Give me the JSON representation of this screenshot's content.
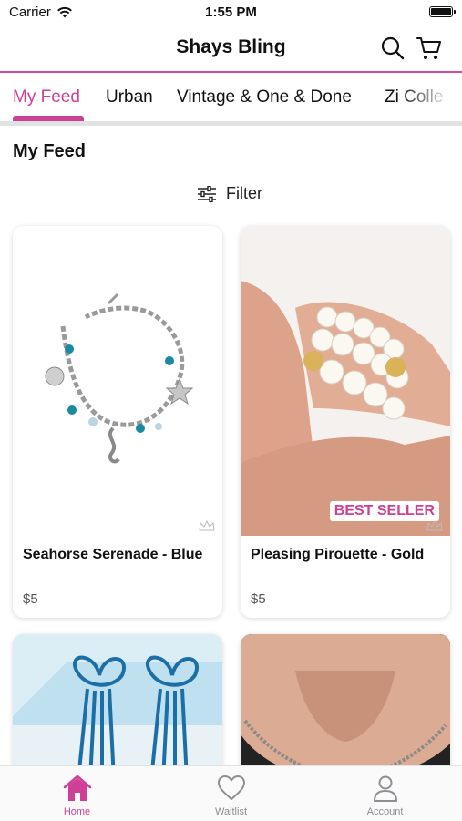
{
  "status_bar": {
    "carrier": "Carrier",
    "time": "1:55 PM"
  },
  "nav": {
    "title": "Shays Bling",
    "icons": [
      "search-icon",
      "cart-icon"
    ]
  },
  "tabs": [
    {
      "label": "My Feed",
      "active": true
    },
    {
      "label": "Urban",
      "active": false
    },
    {
      "label": "Vintage & One & Done",
      "active": false
    },
    {
      "label": "Zi Colle",
      "active": false
    }
  ],
  "feed": {
    "title": "My Feed",
    "filter_label": "Filter",
    "products": [
      {
        "name": "Seahorse Serenade - Blue",
        "price": "$5",
        "badge": ""
      },
      {
        "name": "Pleasing Pirouette - Gold",
        "price": "$5",
        "badge": "BEST SELLER"
      },
      {
        "name": "",
        "price": "",
        "badge": ""
      },
      {
        "name": "",
        "price": "",
        "badge": ""
      }
    ]
  },
  "bottom_nav": [
    {
      "label": "Home",
      "icon": "home-icon",
      "active": true
    },
    {
      "label": "Waitlist",
      "icon": "heart-icon",
      "active": false
    },
    {
      "label": "Account",
      "icon": "person-icon",
      "active": false
    }
  ],
  "colors": {
    "accent": "#cf3f95",
    "inactive": "#8e8e93"
  }
}
